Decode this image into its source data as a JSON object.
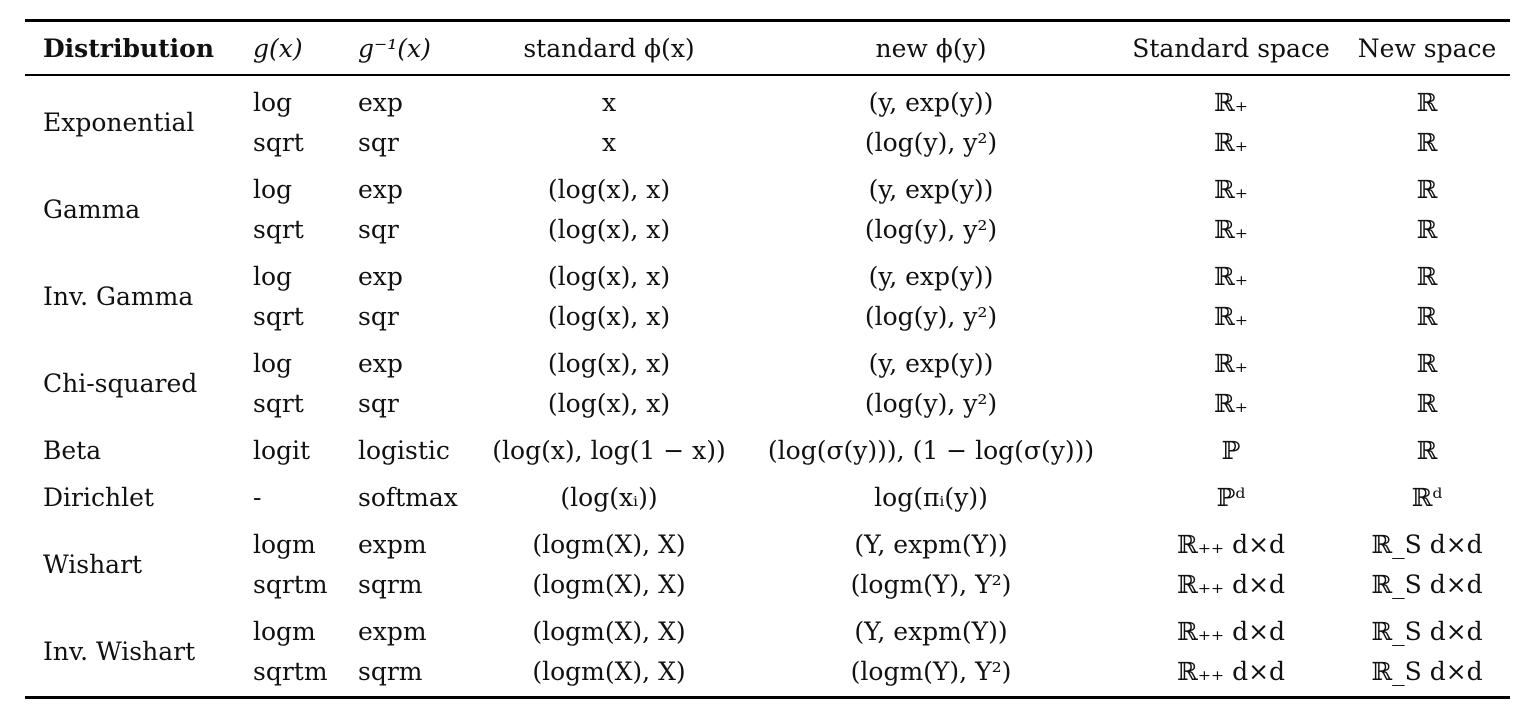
{
  "header": {
    "distribution": "Distribution",
    "g": "g(x)",
    "ginv": "g⁻¹(x)",
    "standard_phi": "standard ϕ(x)",
    "new_phi": "new ϕ(y)",
    "standard_space": "Standard space",
    "new_space": "New space"
  },
  "groups": [
    {
      "name": "Exponential",
      "rows": [
        {
          "g": "log",
          "ginv": "exp",
          "std": "x",
          "new": "(y, exp(y))",
          "ss": "ℝ₊",
          "ns": "ℝ"
        },
        {
          "g": "sqrt",
          "ginv": "sqr",
          "std": "x",
          "new": "(log(y), y²)",
          "ss": "ℝ₊",
          "ns": "ℝ"
        }
      ]
    },
    {
      "name": "Gamma",
      "rows": [
        {
          "g": "log",
          "ginv": "exp",
          "std": "(log(x), x)",
          "new": "(y, exp(y))",
          "ss": "ℝ₊",
          "ns": "ℝ"
        },
        {
          "g": "sqrt",
          "ginv": "sqr",
          "std": "(log(x), x)",
          "new": "(log(y), y²)",
          "ss": "ℝ₊",
          "ns": "ℝ"
        }
      ]
    },
    {
      "name": "Inv. Gamma",
      "rows": [
        {
          "g": "log",
          "ginv": "exp",
          "std": "(log(x), x)",
          "new": "(y, exp(y))",
          "ss": "ℝ₊",
          "ns": "ℝ"
        },
        {
          "g": "sqrt",
          "ginv": "sqr",
          "std": "(log(x), x)",
          "new": "(log(y), y²)",
          "ss": "ℝ₊",
          "ns": "ℝ"
        }
      ]
    },
    {
      "name": "Chi-squared",
      "rows": [
        {
          "g": "log",
          "ginv": "exp",
          "std": "(log(x), x)",
          "new": "(y, exp(y))",
          "ss": "ℝ₊",
          "ns": "ℝ"
        },
        {
          "g": "sqrt",
          "ginv": "sqr",
          "std": "(log(x), x)",
          "new": "(log(y), y²)",
          "ss": "ℝ₊",
          "ns": "ℝ"
        }
      ]
    },
    {
      "name": "Beta",
      "rows": [
        {
          "g": "logit",
          "ginv": "logistic",
          "std": "(log(x), log(1 − x))",
          "new": "(log(σ(y))), (1 − log(σ(y)))",
          "ss": "ℙ",
          "ns": "ℝ"
        }
      ]
    },
    {
      "name": "Dirichlet",
      "rows": [
        {
          "g": "-",
          "ginv": "softmax",
          "std": "(log(xᵢ))",
          "new": "log(πᵢ(y))",
          "ss": "ℙᵈ",
          "ns": "ℝᵈ"
        }
      ]
    },
    {
      "name": "Wishart",
      "rows": [
        {
          "g": "logm",
          "ginv": "expm",
          "std": "(logm(X), X)",
          "new": "(Y, expm(Y))",
          "ss": "ℝ₊₊ d×d",
          "ns": "ℝ_S d×d"
        },
        {
          "g": "sqrtm",
          "ginv": "sqrm",
          "std": "(logm(X), X)",
          "new": "(logm(Y), Y²)",
          "ss": "ℝ₊₊ d×d",
          "ns": "ℝ_S d×d"
        }
      ]
    },
    {
      "name": "Inv. Wishart",
      "rows": [
        {
          "g": "logm",
          "ginv": "expm",
          "std": "(logm(X), X)",
          "new": "(Y, expm(Y))",
          "ss": "ℝ₊₊ d×d",
          "ns": "ℝ_S d×d"
        },
        {
          "g": "sqrtm",
          "ginv": "sqrm",
          "std": "(logm(X), X)",
          "new": "(logm(Y), Y²)",
          "ss": "ℝ₊₊ d×d",
          "ns": "ℝ_S d×d"
        }
      ]
    }
  ]
}
